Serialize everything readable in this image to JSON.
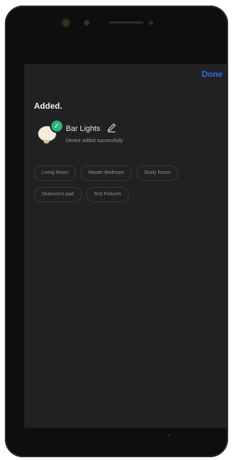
{
  "header": {
    "done_label": "Done"
  },
  "page": {
    "title": "Added."
  },
  "device": {
    "name": "Bar Lights",
    "status": "Device added successfully"
  },
  "rooms": [
    "Living Room",
    "Master Bedroom",
    "Study Room",
    "Shannon's pad",
    "Test Fixtures"
  ],
  "colors": {
    "screen_bg": "#212123",
    "accent_blue": "#2f6fe6",
    "success_green": "#2ab27b"
  },
  "icons": {
    "check": "check-icon",
    "edit": "pencil-icon",
    "device": "bulb-icon"
  }
}
